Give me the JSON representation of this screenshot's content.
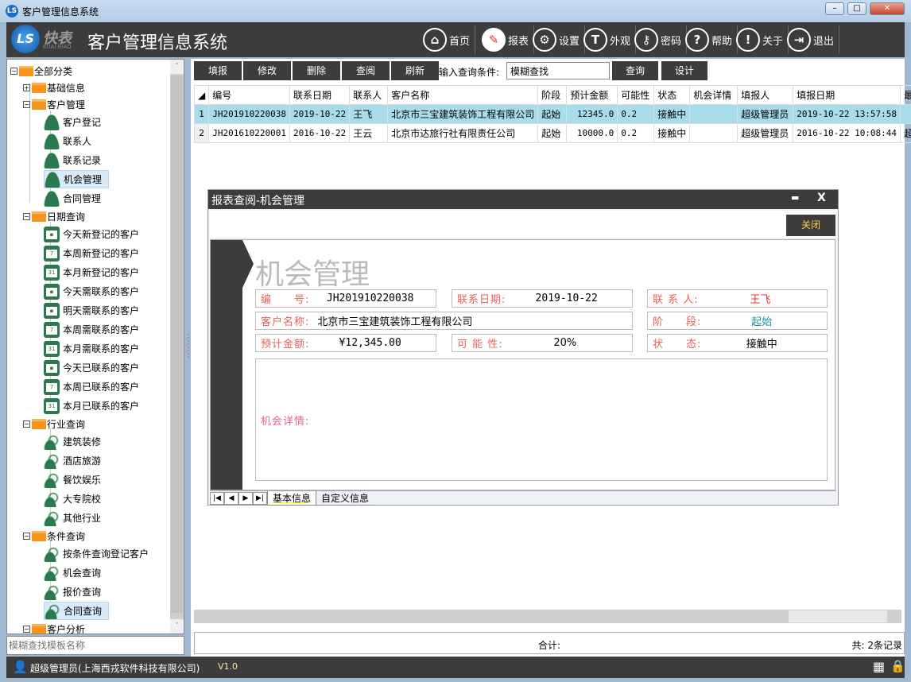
{
  "window": {
    "title": "客户管理信息系统",
    "min": "–",
    "max": "□",
    "close": "✕",
    "logo_mark": "LS"
  },
  "header": {
    "logo_text": "快表",
    "logo_sub": "KUAI BIAO",
    "title": "客户管理信息系统",
    "nav": [
      {
        "label": "首页",
        "icon": "⌂"
      },
      {
        "label": "报表",
        "icon": "✎"
      },
      {
        "label": "设置",
        "icon": "⚙"
      },
      {
        "label": "外观",
        "icon": "T"
      },
      {
        "label": "密码",
        "icon": "⚷"
      },
      {
        "label": "帮助",
        "icon": "?"
      },
      {
        "label": "关于",
        "icon": "!"
      },
      {
        "label": "退出",
        "icon": "⇥"
      }
    ]
  },
  "tree": {
    "root": "全部分类",
    "basic": "基础信息",
    "cust": "客户管理",
    "cust_items": [
      "客户登记",
      "联系人",
      "联系记录",
      "机会管理",
      "合同管理"
    ],
    "date": "日期查询",
    "date_items": [
      "今天新登记的客户",
      "本周新登记的客户",
      "本月新登记的客户",
      "今天需联系的客户",
      "明天需联系的客户",
      "本周需联系的客户",
      "本月需联系的客户",
      "今天已联系的客户",
      "本周已联系的客户",
      "本月已联系的客户"
    ],
    "industry": "行业查询",
    "industry_items": [
      "建筑装修",
      "酒店旅游",
      "餐饮娱乐",
      "大专院校",
      "其他行业"
    ],
    "cond": "条件查询",
    "cond_items": [
      "按条件查询登记客户",
      "机会查询",
      "报价查询",
      "合同查询"
    ],
    "analysis": "客户分析",
    "search_placeholder": "模糊查找模板名称"
  },
  "toolbar": {
    "buttons": [
      "填报",
      "修改",
      "删除",
      "查阅",
      "刷新"
    ],
    "query_label": "输入查询条件:",
    "query_value": "模糊查找",
    "query_btn": "查询",
    "design_btn": "设计"
  },
  "table": {
    "headers": [
      "编号",
      "联系日期",
      "联系人",
      "客户名称",
      "阶段",
      "预计金额",
      "可能性",
      "状态",
      "机会详情",
      "填报人",
      "填报日期",
      "最"
    ],
    "rows": [
      [
        "1",
        "JH201910220038",
        "2019-10-22",
        "王飞",
        "北京市三宝建筑装饰工程有限公司",
        "起始",
        "12345.0",
        "0.2",
        "接触中",
        "",
        "超级管理员",
        "2019-10-22 13:57:58",
        ""
      ],
      [
        "2",
        "JH201610220001",
        "2016-10-22",
        "王云",
        "北京市达旅行社有限责任公司",
        "起始",
        "10000.0",
        "0.2",
        "接触中",
        "",
        "超级管理员",
        "2016-10-22 10:08:44",
        "超"
      ]
    ]
  },
  "footer": {
    "sum_label": "合计:",
    "count": "共: 2条记录"
  },
  "status": {
    "user": "超级管理员(上海西戎软件科技有限公司)",
    "version": "V1.0"
  },
  "modal": {
    "title": "报表查阅-机会管理",
    "min": "▬",
    "close": "X",
    "close_btn": "关闭",
    "report_title": "机会管理",
    "fields": {
      "code_l": "编　　号:",
      "code_v": "JH201910220038",
      "date_l": "联系日期:",
      "date_v": "2019-10-22",
      "contact_l": "联 系 人:",
      "contact_v": "王飞",
      "cust_l": "客户名称:",
      "cust_v": "北京市三宝建筑装饰工程有限公司",
      "stage_l": "阶　　段:",
      "stage_v": "起始",
      "amount_l": "预计金额:",
      "amount_v": "¥12,345.00",
      "prob_l": "可 能 性:",
      "prob_v": "20%",
      "state_l": "状　　态:",
      "state_v": "接触中",
      "detail_l": "机会详情:"
    },
    "tabs": [
      "基本信息",
      "自定义信息"
    ]
  }
}
